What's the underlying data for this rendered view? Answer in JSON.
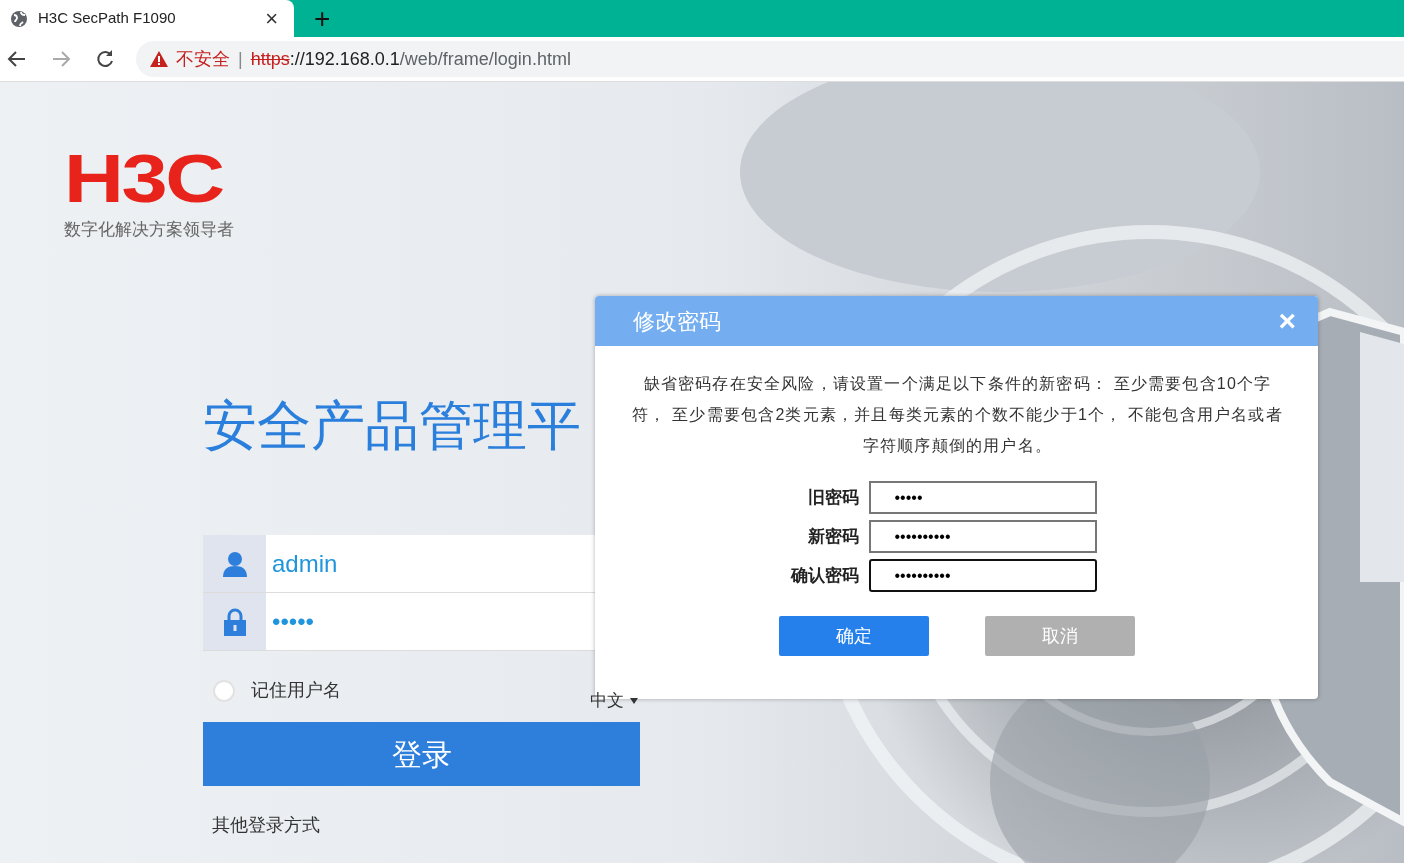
{
  "browser": {
    "tab": {
      "title": "H3C SecPath F1090",
      "close": "×"
    },
    "new_tab": "+",
    "address": {
      "security_label": "不安全",
      "separator": "|",
      "scheme": "https",
      "host": "://192.168.0.1",
      "path": "/web/frame/login.html"
    }
  },
  "page": {
    "logo": {
      "text": "H3C",
      "tagline": "数字化解决方案领导者"
    },
    "title": "安全产品管理平",
    "login": {
      "username": {
        "value": "admin"
      },
      "password": {
        "value": "•••••"
      },
      "remember": {
        "label": "记住用户名",
        "checked": false
      },
      "language": "中文",
      "submit": "登录",
      "other": "其他登录方式"
    }
  },
  "dialog": {
    "title": "修改密码",
    "close": "×",
    "message": "缺省密码存在安全风险，请设置一个满足以下条件的新密码： 至少需要包含10个字符， 至少需要包含2类元素，并且每类元素的个数不能少于1个， 不能包含用户名或者字符顺序颠倒的用户名。",
    "fields": [
      {
        "label": "旧密码",
        "value": "•••••",
        "focused": false
      },
      {
        "label": "新密码",
        "value": "••••••••••",
        "focused": false
      },
      {
        "label": "确认密码",
        "value": "••••••••••",
        "focused": true
      }
    ],
    "buttons": [
      {
        "label": "确定",
        "kind": "primary"
      },
      {
        "label": "取消",
        "kind": "secondary"
      }
    ]
  }
}
